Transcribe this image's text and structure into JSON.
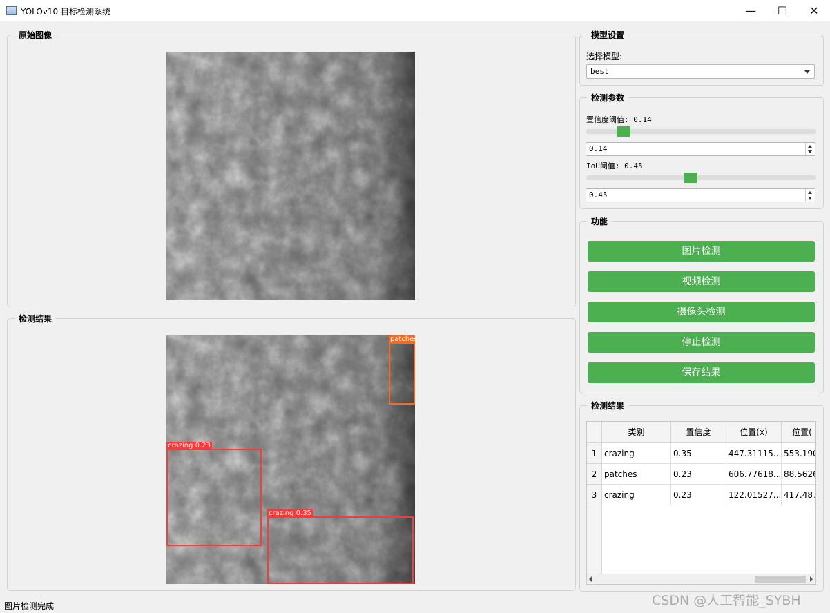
{
  "window": {
    "title": "YOLOv10 目标检测系统",
    "minimize": "—",
    "maximize": "☐",
    "close": "✕"
  },
  "original": {
    "group_title": "原始图像"
  },
  "result_image": {
    "group_title": "检测结果",
    "detections": [
      {
        "label": "patches",
        "color": "#f26d21"
      },
      {
        "label": "crazing 0.23",
        "color": "#ff3838"
      },
      {
        "label": "crazing 0.35",
        "color": "#ff3838"
      }
    ]
  },
  "model": {
    "group_title": "模型设置",
    "select_label": "选择模型:",
    "selected": "best"
  },
  "params": {
    "group_title": "检测参数",
    "confidence_label": "置信度阈值: 0.14",
    "confidence_value": "0.14",
    "confidence": 0.14,
    "iou_label": "IoU阈值: 0.45",
    "iou_value": "0.45",
    "iou": 0.45
  },
  "functions": {
    "group_title": "功能",
    "buttons": [
      "图片检测",
      "视频检测",
      "摄像头检测",
      "停止检测",
      "保存结果"
    ]
  },
  "results": {
    "group_title": "检测结果",
    "columns": [
      "类别",
      "置信度",
      "位置(x)",
      "位置("
    ],
    "rows": [
      {
        "index": "1",
        "cells": [
          "crazing",
          "0.35",
          "447.31115...",
          "553.190"
        ]
      },
      {
        "index": "2",
        "cells": [
          "patches",
          "0.23",
          "606.77618...",
          "88.5626"
        ]
      },
      {
        "index": "3",
        "cells": [
          "crazing",
          "0.23",
          "122.01527...",
          "417.487"
        ]
      }
    ]
  },
  "status": "图片检测完成",
  "watermark": "CSDN @人工智能_SYBH",
  "colors": {
    "accent": "#4caf50",
    "box_red": "#ff3838",
    "box_orange": "#f26d21"
  }
}
